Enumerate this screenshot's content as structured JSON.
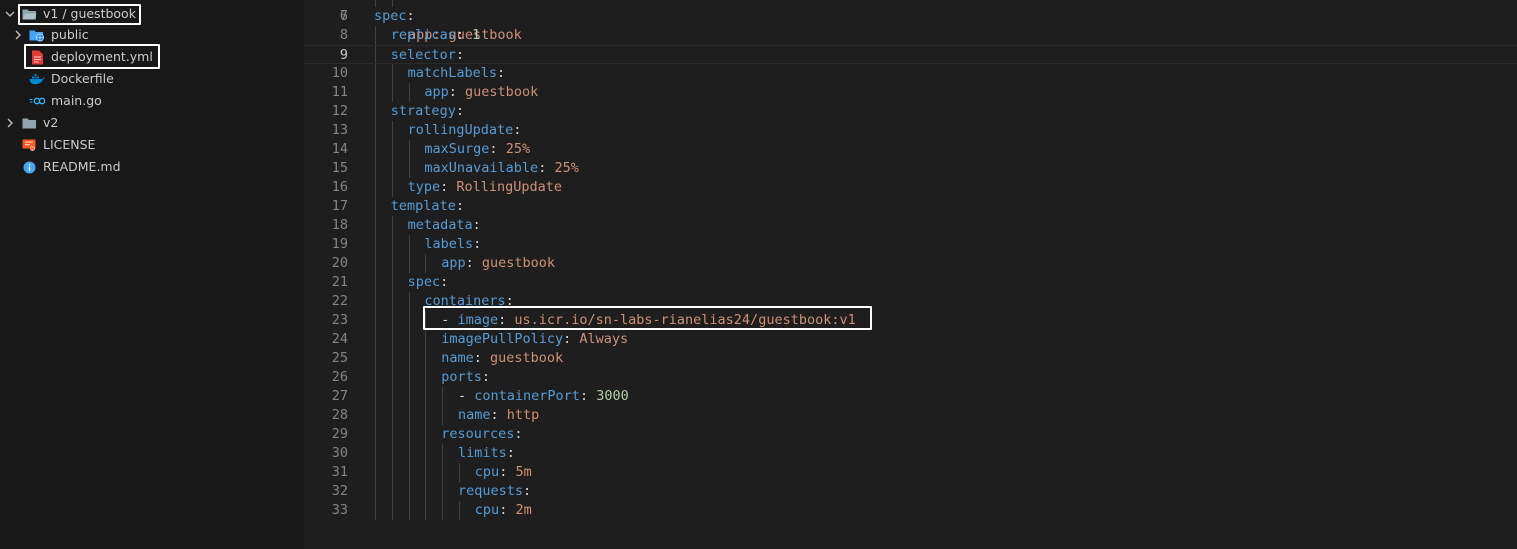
{
  "explorer": {
    "items": [
      {
        "label": "v1 / guestbook",
        "icon": "folder-open-icon",
        "chevron": "chevron-down-icon"
      },
      {
        "label": "public",
        "icon": "folder-globe-icon",
        "chevron": "chevron-right-icon"
      },
      {
        "label": "deployment.yml",
        "icon": "yaml-file-icon"
      },
      {
        "label": "Dockerfile",
        "icon": "docker-icon"
      },
      {
        "label": "main.go",
        "icon": "go-file-icon"
      },
      {
        "label": "v2",
        "icon": "folder-icon",
        "chevron": "chevron-right-icon"
      },
      {
        "label": "LICENSE",
        "icon": "license-icon"
      },
      {
        "label": "README.md",
        "icon": "info-icon"
      }
    ]
  },
  "editor": {
    "top_partial": {
      "number": "6",
      "text": "app: guestbook"
    },
    "active_line": "9",
    "lines": [
      {
        "n": "7",
        "tokens": [
          {
            "t": "spec",
            "c": "k"
          },
          {
            "t": ":",
            "c": "p"
          }
        ]
      },
      {
        "n": "8",
        "tokens": [
          {
            "t": "replicas",
            "c": "k"
          },
          {
            "t": ": ",
            "c": "p"
          },
          {
            "t": "1",
            "c": "n"
          }
        ]
      },
      {
        "n": "9",
        "tokens": [
          {
            "t": "selector",
            "c": "k"
          },
          {
            "t": ":",
            "c": "p"
          }
        ]
      },
      {
        "n": "10",
        "tokens": [
          {
            "t": "matchLabels",
            "c": "k"
          },
          {
            "t": ":",
            "c": "p"
          }
        ]
      },
      {
        "n": "11",
        "tokens": [
          {
            "t": "app",
            "c": "k"
          },
          {
            "t": ": ",
            "c": "p"
          },
          {
            "t": "guestbook",
            "c": "s"
          }
        ]
      },
      {
        "n": "12",
        "tokens": [
          {
            "t": "strategy",
            "c": "k"
          },
          {
            "t": ":",
            "c": "p"
          }
        ]
      },
      {
        "n": "13",
        "tokens": [
          {
            "t": "rollingUpdate",
            "c": "k"
          },
          {
            "t": ":",
            "c": "p"
          }
        ]
      },
      {
        "n": "14",
        "tokens": [
          {
            "t": "maxSurge",
            "c": "k"
          },
          {
            "t": ": ",
            "c": "p"
          },
          {
            "t": "25%",
            "c": "s"
          }
        ]
      },
      {
        "n": "15",
        "tokens": [
          {
            "t": "maxUnavailable",
            "c": "k"
          },
          {
            "t": ": ",
            "c": "p"
          },
          {
            "t": "25%",
            "c": "s"
          }
        ]
      },
      {
        "n": "16",
        "tokens": [
          {
            "t": "type",
            "c": "k"
          },
          {
            "t": ": ",
            "c": "p"
          },
          {
            "t": "RollingUpdate",
            "c": "s"
          }
        ]
      },
      {
        "n": "17",
        "tokens": [
          {
            "t": "template",
            "c": "k"
          },
          {
            "t": ":",
            "c": "p"
          }
        ]
      },
      {
        "n": "18",
        "tokens": [
          {
            "t": "metadata",
            "c": "k"
          },
          {
            "t": ":",
            "c": "p"
          }
        ]
      },
      {
        "n": "19",
        "tokens": [
          {
            "t": "labels",
            "c": "k"
          },
          {
            "t": ":",
            "c": "p"
          }
        ]
      },
      {
        "n": "20",
        "tokens": [
          {
            "t": "app",
            "c": "k"
          },
          {
            "t": ": ",
            "c": "p"
          },
          {
            "t": "guestbook",
            "c": "s"
          }
        ]
      },
      {
        "n": "21",
        "tokens": [
          {
            "t": "spec",
            "c": "k"
          },
          {
            "t": ":",
            "c": "p"
          }
        ]
      },
      {
        "n": "22",
        "tokens": [
          {
            "t": "containers",
            "c": "k"
          },
          {
            "t": ":",
            "c": "p"
          }
        ]
      },
      {
        "n": "23",
        "tokens": [
          {
            "t": "- ",
            "c": "p"
          },
          {
            "t": "image",
            "c": "k"
          },
          {
            "t": ": ",
            "c": "p"
          },
          {
            "t": "us.icr.io/sn-labs-rianelias24/guestbook:v1",
            "c": "s"
          }
        ]
      },
      {
        "n": "24",
        "tokens": [
          {
            "t": "imagePullPolicy",
            "c": "k"
          },
          {
            "t": ": ",
            "c": "p"
          },
          {
            "t": "Always",
            "c": "s"
          }
        ]
      },
      {
        "n": "25",
        "tokens": [
          {
            "t": "name",
            "c": "k"
          },
          {
            "t": ": ",
            "c": "p"
          },
          {
            "t": "guestbook",
            "c": "s"
          }
        ]
      },
      {
        "n": "26",
        "tokens": [
          {
            "t": "ports",
            "c": "k"
          },
          {
            "t": ":",
            "c": "p"
          }
        ]
      },
      {
        "n": "27",
        "tokens": [
          {
            "t": "- ",
            "c": "p"
          },
          {
            "t": "containerPort",
            "c": "k"
          },
          {
            "t": ": ",
            "c": "p"
          },
          {
            "t": "3000",
            "c": "n"
          }
        ]
      },
      {
        "n": "28",
        "tokens": [
          {
            "t": "name",
            "c": "k"
          },
          {
            "t": ": ",
            "c": "p"
          },
          {
            "t": "http",
            "c": "s"
          }
        ]
      },
      {
        "n": "29",
        "tokens": [
          {
            "t": "resources",
            "c": "k"
          },
          {
            "t": ":",
            "c": "p"
          }
        ]
      },
      {
        "n": "30",
        "tokens": [
          {
            "t": "limits",
            "c": "k"
          },
          {
            "t": ":",
            "c": "p"
          }
        ]
      },
      {
        "n": "31",
        "tokens": [
          {
            "t": "cpu",
            "c": "k"
          },
          {
            "t": ": ",
            "c": "p"
          },
          {
            "t": "5m",
            "c": "s"
          }
        ]
      },
      {
        "n": "32",
        "tokens": [
          {
            "t": "requests",
            "c": "k"
          },
          {
            "t": ":",
            "c": "p"
          }
        ]
      },
      {
        "n": "33",
        "tokens": [
          {
            "t": "cpu",
            "c": "k"
          },
          {
            "t": ": ",
            "c": "p"
          },
          {
            "t": "2m",
            "c": "s"
          }
        ]
      }
    ]
  },
  "colors": {
    "sidebar_bg": "#181818",
    "editor_bg": "#1e1e1e",
    "key": "#569cd6",
    "string": "#ce9178",
    "number": "#b5cea8",
    "highlight_box": "#ffffff"
  }
}
